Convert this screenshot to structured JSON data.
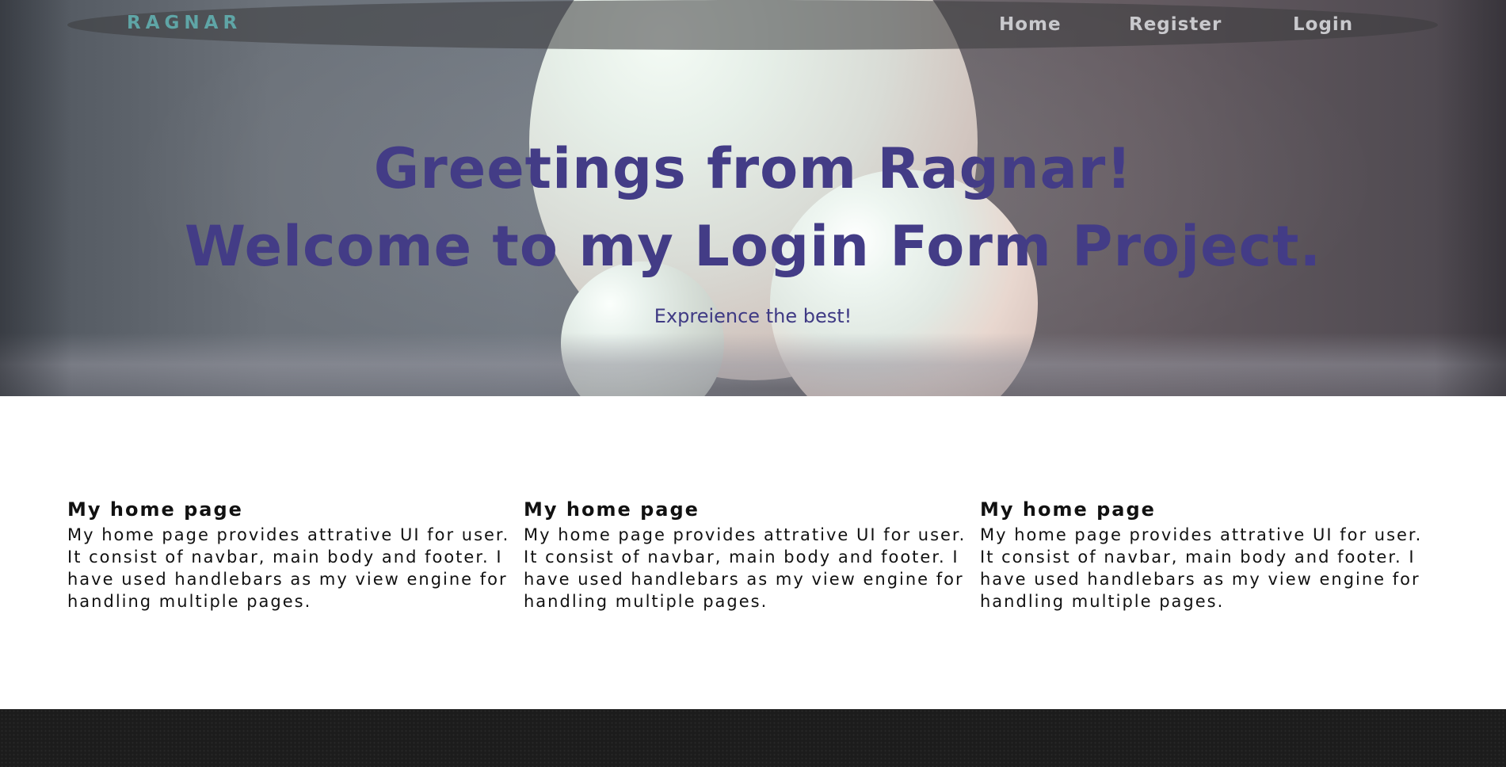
{
  "nav": {
    "brand": "RAGNAR",
    "links": [
      {
        "label": "Home"
      },
      {
        "label": "Register"
      },
      {
        "label": "Login"
      }
    ]
  },
  "hero": {
    "line1": "Greetings from Ragnar!",
    "line2": "Welcome to my Login Form Project.",
    "tagline": "Expreience the best!"
  },
  "columns": [
    {
      "title": "My home page",
      "text": "My home page provides attrative UI for user. It consist of navbar, main body and footer. I have used handlebars as my view engine for handling multiple pages."
    },
    {
      "title": "My home page",
      "text": "My home page provides attrative UI for user. It consist of navbar, main body and footer. I have used handlebars as my view engine for handling multiple pages."
    },
    {
      "title": "My home page",
      "text": "My home page provides attrative UI for user. It consist of navbar, main body and footer. I have used handlebars as my view engine for handling multiple pages."
    }
  ],
  "colors": {
    "brand": "#5fa5a6",
    "heading": "#433c86",
    "nav_link": "#c9c9cd",
    "footer": "#1c1c1c"
  }
}
